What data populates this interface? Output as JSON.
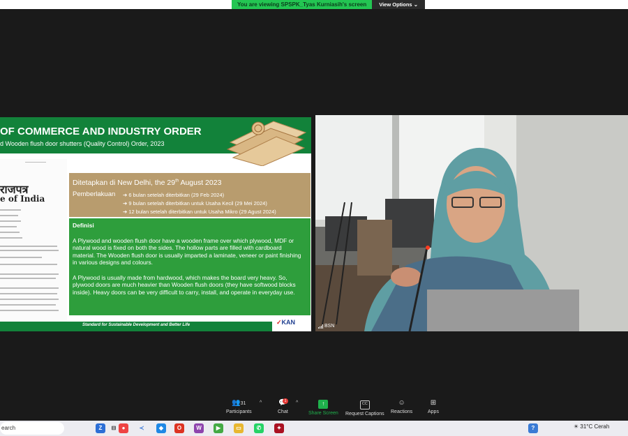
{
  "banner": {
    "viewing_text": "You are viewing SPSPK_Tyas Kurniasih's screen",
    "view_options_label": "View Options"
  },
  "slide": {
    "title": "OF COMMERCE AND INDUSTRY ORDER",
    "subtitle": "d Wooden flush door shutters (Quality Control) Order, 2023",
    "gazette_title": "राजपत्र",
    "gazette_subtitle": "e of India",
    "established": {
      "prefix": "Ditetapkan di New Delhi, the 29",
      "sup": "th",
      "suffix": " August 2023"
    },
    "pemberlakuan_label": "Pemberlakuan",
    "pemberlakuan_items": [
      "➔ 6 bulan setelah diterbitkan  (29 Feb 2024)",
      "➔ 9 bulan setelah diterbitkan untuk Usaha Kecil (29 Mei 2024)",
      "➔ 12 bulan setelah diterbitkan untuk Usaha Mikro (29 Agust 2024)"
    ],
    "definisi_label": "Definisi",
    "para1": "A Plywood and wooden flush door have a wooden frame over which plywood, MDF or natural wood is fixed on both the sides. The hollow parts are filled with cardboard material. The Wooden flush door is usually imparted a laminate, veneer or paint finishing in various designs and colours.",
    "para2": "A Plywood is usually made from hardwood, which makes the board very heavy. So, plywood doors are much heavier than Wooden flush doors (they have softwood blocks inside). Heavy doors can be very difficult to carry, install, and operate in everyday use.",
    "footer": "Standard for Sustainable Development and Better Life",
    "logo_text": "KAN"
  },
  "participant": {
    "name": "BSN"
  },
  "controls": {
    "participants_label": "Participants",
    "participants_count": "31",
    "chat_label": "Chat",
    "chat_badge": "1",
    "share_label": "Share Screen",
    "captions_label": "Request Captions",
    "reactions_label": "Reactions",
    "apps_label": "Apps"
  },
  "taskbar": {
    "search_text": "earch",
    "weather_temp": "31°C",
    "weather_text": "Cerah"
  },
  "colors": {
    "slide_green": "#12823a",
    "box_green": "#2e9e3c",
    "box_tan": "#b89c6e",
    "share_green": "#1fb14c",
    "banner_green": "#23c552"
  }
}
